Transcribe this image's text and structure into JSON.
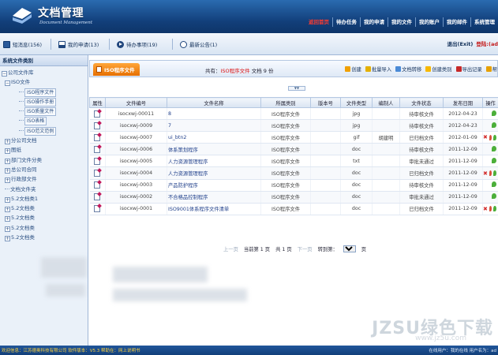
{
  "header": {
    "title": "文档管理",
    "subtitle": "Document Management",
    "nav": [
      {
        "label": "返回首页",
        "active": true
      },
      {
        "label": "待办任务"
      },
      {
        "label": "我的申请"
      },
      {
        "label": "我的文件"
      },
      {
        "label": "我的账户"
      },
      {
        "label": "我的邮件"
      },
      {
        "label": "系统管理"
      }
    ]
  },
  "toolbar": {
    "messages": "短消息(156)",
    "applications": "我的申请(13)",
    "todo": "待办事项(19)",
    "notices": "最新公告(1)",
    "exit": "退出(Exit)",
    "user": "登陆:(ad"
  },
  "sidebar": {
    "title": "系统文件类别",
    "tree": [
      {
        "label": "公司文件库",
        "level": 0,
        "toggle": "-"
      },
      {
        "label": "ISO文件",
        "level": 1,
        "toggle": "-"
      },
      {
        "label": "ISO程序文件",
        "level": 3
      },
      {
        "label": "ISO操作手册",
        "level": 3
      },
      {
        "label": "ISO质量文件",
        "level": 3
      },
      {
        "label": "ISO表格",
        "level": 3
      },
      {
        "label": "ISO范文范例",
        "level": 3
      },
      {
        "label": "分公司文档",
        "level": 1,
        "toggle": "+"
      },
      {
        "label": "图纸",
        "level": 1,
        "toggle": "+"
      },
      {
        "label": "部门文件分类",
        "level": 1,
        "toggle": "+"
      },
      {
        "label": "总公司合同",
        "level": 1,
        "toggle": "+"
      },
      {
        "label": "行政部文件",
        "level": 1,
        "toggle": "+"
      },
      {
        "label": "文档文件夹",
        "level": 1,
        "line": true
      },
      {
        "label": "5.2文档类1",
        "level": 1,
        "toggle": "+"
      },
      {
        "label": "5.2文档类",
        "level": 1,
        "toggle": "+"
      },
      {
        "label": "5.2文档类",
        "level": 1,
        "toggle": "+"
      },
      {
        "label": "5.2文档类",
        "level": 1,
        "toggle": "+"
      },
      {
        "label": "5.2文档类",
        "level": 1,
        "toggle": "+"
      }
    ]
  },
  "panel": {
    "tab_label": "ISO程序文件",
    "count_prefix": "共有：",
    "count_category": "ISO程序文件",
    "count_suffix": " 文档 9 份",
    "actions": [
      "创建",
      "批量导入",
      "文档转移",
      "创建类别",
      "导出记录",
      "帮"
    ]
  },
  "table": {
    "columns": [
      "属性",
      "文件编号",
      "文件名称",
      "所属类别",
      "版本号",
      "文件类型",
      "编制人",
      "文件状态",
      "发布日期",
      "操作"
    ],
    "rows": [
      {
        "code": "isocxwj-00011",
        "name": "8",
        "category": "ISO程序文件",
        "version": "",
        "type": "jpg",
        "author": "",
        "status": "待审核文件",
        "date": "2012-04-23",
        "ops": [
          "leaf-green"
        ]
      },
      {
        "code": "isocxwj-0009",
        "name": "7",
        "category": "ISO程序文件",
        "version": "",
        "type": "jpg",
        "author": "",
        "status": "待审核文件",
        "date": "2012-04-23",
        "ops": [
          "leaf-green"
        ]
      },
      {
        "code": "isocxwj-0007",
        "name": "ui_btn2",
        "category": "ISO程序文件",
        "version": "",
        "type": "gif",
        "author": "胡建明",
        "status": "已归档文件",
        "date": "2012-01-09",
        "ops": [
          "x",
          "leaf-red",
          "leaf-green"
        ]
      },
      {
        "code": "isocxwj-0006",
        "name": "体系策划程序",
        "category": "ISO程序文件",
        "version": "",
        "type": "doc",
        "author": "",
        "status": "待审核文件",
        "date": "2011-12-09",
        "ops": [
          "leaf-green"
        ]
      },
      {
        "code": "isocxwj-0005",
        "name": "人力资源管理程序",
        "category": "ISO程序文件",
        "version": "",
        "type": "txt",
        "author": "",
        "status": "审批未通过",
        "date": "2011-12-09",
        "ops": [
          "leaf-green"
        ]
      },
      {
        "code": "isocxwj-0004",
        "name": "人力资源管理程序",
        "category": "ISO程序文件",
        "version": "",
        "type": "doc",
        "author": "",
        "status": "已归档文件",
        "date": "2011-12-09",
        "ops": [
          "x",
          "leaf-red",
          "leaf-green"
        ]
      },
      {
        "code": "isocxwj-0003",
        "name": "产品防护程序",
        "category": "ISO程序文件",
        "version": "",
        "type": "doc",
        "author": "",
        "status": "待审核文件",
        "date": "2011-12-09",
        "ops": [
          "leaf-green"
        ]
      },
      {
        "code": "isocxwj-0002",
        "name": "不合格品控制程序",
        "category": "ISO程序文件",
        "version": "",
        "type": "doc",
        "author": "",
        "status": "审批未通过",
        "date": "2011-12-09",
        "ops": [
          "leaf-green"
        ]
      },
      {
        "code": "isocxwj-0001",
        "name": "ISO9001体系程序文件清单",
        "category": "ISO程序文件",
        "version": "",
        "type": "doc",
        "author": "",
        "status": "已归档文件",
        "date": "2011-12-09",
        "ops": [
          "x",
          "leaf-red",
          "leaf-green"
        ]
      }
    ]
  },
  "pager": {
    "prev": "上一页",
    "current": "当前第 1 页",
    "total": "共 1 页",
    "next": "下一页",
    "goto": "转到第：",
    "selected": "1",
    "page_unit": "页"
  },
  "watermark": {
    "text": "JZSU绿色下载",
    "url": "www.jz5u.com"
  },
  "status": {
    "left": "欢迎信息：江苏德奥科技有限公司  软件版本：V5.3     帮助在：网上说明书",
    "right": "在线用户：我的在线  用户名为：ad"
  },
  "colors": {
    "header": "#123f7a",
    "accent_orange": "#e66f00",
    "nav_active": "#ff3b30",
    "status_text": "#ffd23c"
  }
}
